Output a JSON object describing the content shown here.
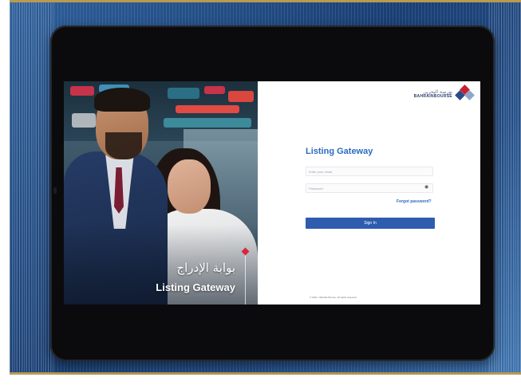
{
  "left_panel": {
    "arabic_title": "بوابة الإدراج",
    "english_title": "Listing Gateway"
  },
  "brand": {
    "name_arabic": "بورصة البحرين",
    "name_english": "BAHRAINBOURSE"
  },
  "login": {
    "title": "Listing Gateway",
    "email_placeholder": "Enter your email",
    "password_placeholder": "Password",
    "forgot_label": "Forgot password?",
    "signin_label": "Sign In",
    "copyright": "© 2024 - Bahrain Bourse. All rights reserved."
  },
  "colors": {
    "accent_blue": "#2c6bc0",
    "button_blue": "#2f5cae",
    "brand_red": "#c8202f",
    "background_blue": "#1a3f74"
  },
  "icons": {
    "password_toggle": "eye-icon"
  }
}
